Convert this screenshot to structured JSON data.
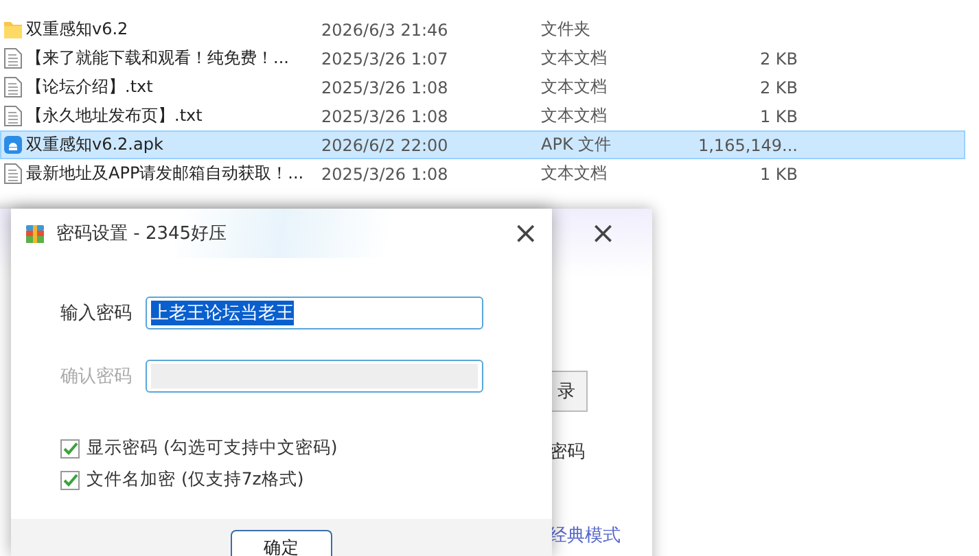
{
  "files": [
    {
      "kind": "folder",
      "name": "双重感知v6.2",
      "modified": "2026/6/3 21:46",
      "type": "文件夹",
      "selected": false
    },
    {
      "kind": "text",
      "name": "【来了就能下载和观看！纯免费！...",
      "modified": "2025/3/26 1:07",
      "type": "文本文档",
      "size": "2 KB",
      "selected": false
    },
    {
      "kind": "text",
      "name": "【论坛介绍】.txt",
      "modified": "2025/3/26 1:08",
      "type": "文本文档",
      "size": "2 KB",
      "selected": false
    },
    {
      "kind": "text",
      "name": "【永久地址发布页】.txt",
      "modified": "2025/3/26 1:08",
      "type": "文本文档",
      "size": "1 KB",
      "selected": false
    },
    {
      "kind": "apk",
      "name": "双重感知v6.2.apk",
      "modified": "2026/6/2 22:00",
      "type": "APK 文件",
      "size": "1,165,149...",
      "selected": true
    },
    {
      "kind": "text",
      "name": "最新地址及APP请发邮箱自动获取！...",
      "modified": "2025/3/26 1:08",
      "type": "文本文档",
      "size": "1 KB",
      "selected": false
    }
  ],
  "back_dialog": {
    "close": "×",
    "button": "录",
    "text": "密码",
    "link": "经典模式"
  },
  "dialog": {
    "title": "密码设置 - 2345好压",
    "close": "×",
    "fields": [
      {
        "label": "输入密码",
        "value": "上老王论坛当老王",
        "disabled": false,
        "text_selected": true
      },
      {
        "label": "确认密码",
        "disabled": true
      }
    ],
    "checkboxes": [
      {
        "label": "显示密码 (勾选可支持中文密码)",
        "checked": true
      },
      {
        "label": "文件名加密  (仅支持7z格式)",
        "checked": true
      }
    ],
    "button": "确定"
  }
}
